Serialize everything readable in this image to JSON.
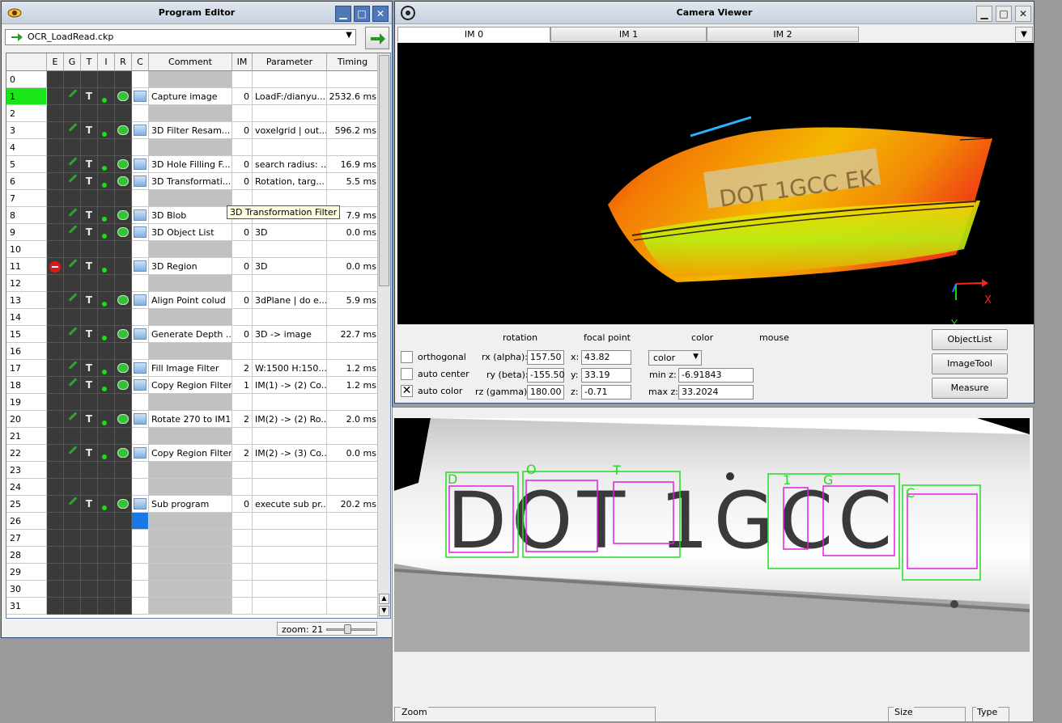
{
  "program_editor": {
    "title": "Program Editor",
    "file": "OCR_LoadRead.ckp",
    "columns": [
      "E",
      "G",
      "T",
      "I",
      "R",
      "C",
      "Comment",
      "IM",
      "Parameter",
      "Timing"
    ],
    "rows": [
      {
        "n": "0"
      },
      {
        "n": "1",
        "comment": "Capture image",
        "im": "0",
        "param": "LoadF:/dianyu...",
        "timing": "2532.6 ms",
        "en": true
      },
      {
        "n": "2"
      },
      {
        "n": "3",
        "comment": "3D Filter Resam...",
        "im": "0",
        "param": "voxelgrid | out...",
        "timing": "596.2 ms",
        "en": true
      },
      {
        "n": "4"
      },
      {
        "n": "5",
        "comment": "3D Hole Filling F...",
        "im": "0",
        "param": "search radius: ...",
        "timing": "16.9 ms",
        "en": true
      },
      {
        "n": "6",
        "comment": "3D Transformati...",
        "im": "0",
        "param": "Rotation, targ...",
        "timing": "5.5 ms",
        "en": true
      },
      {
        "n": "7"
      },
      {
        "n": "8",
        "comment": "3D Blob",
        "im": "",
        "param": "",
        "timing": "7.9 ms",
        "en": true
      },
      {
        "n": "9",
        "comment": "3D Object List",
        "im": "0",
        "param": "3D",
        "timing": "0.0 ms",
        "en": true
      },
      {
        "n": "10"
      },
      {
        "n": "11",
        "comment": "3D Region",
        "im": "0",
        "param": "3D",
        "timing": "0.0 ms",
        "en": true,
        "disabled": true
      },
      {
        "n": "12"
      },
      {
        "n": "13",
        "comment": "Align Point colud",
        "im": "0",
        "param": "3dPlane | do e...",
        "timing": "5.9 ms",
        "en": true
      },
      {
        "n": "14"
      },
      {
        "n": "15",
        "comment": "Generate Depth ...",
        "im": "0",
        "param": "3D -> image",
        "timing": "22.7 ms",
        "en": true
      },
      {
        "n": "16"
      },
      {
        "n": "17",
        "comment": "Fill Image Filter",
        "im": "2",
        "param": "W:1500 H:150...",
        "timing": "1.2 ms",
        "en": true
      },
      {
        "n": "18",
        "comment": "Copy Region Filter",
        "im": "1",
        "param": "IM(1) -> (2)  Co...",
        "timing": "1.2 ms",
        "en": true
      },
      {
        "n": "19"
      },
      {
        "n": "20",
        "comment": "Rotate 270 to IM1",
        "im": "2",
        "param": "IM(2) -> (2)  Ro...",
        "timing": "2.0 ms",
        "en": true
      },
      {
        "n": "21"
      },
      {
        "n": "22",
        "comment": "Copy Region Filter",
        "im": "2",
        "param": "IM(2) -> (3)  Co...",
        "timing": "0.0 ms",
        "en": true
      },
      {
        "n": "23"
      },
      {
        "n": "24"
      },
      {
        "n": "25",
        "comment": "Sub program",
        "im": "0",
        "param": "execute sub pr...",
        "timing": "20.2 ms",
        "en": true
      },
      {
        "n": "26"
      },
      {
        "n": "27"
      },
      {
        "n": "28"
      },
      {
        "n": "29"
      },
      {
        "n": "30"
      },
      {
        "n": "31"
      }
    ],
    "tooltip": "3D Transformation Filter",
    "zoom_label": "zoom: 21"
  },
  "camera_viewer": {
    "title": "Camera Viewer",
    "tabs": [
      "IM 0",
      "IM 1",
      "IM 2"
    ],
    "headers": {
      "rotation": "rotation",
      "focal": "focal point",
      "color": "color",
      "mouse": "mouse"
    },
    "options": [
      {
        "label": "orthogonal",
        "checked": false
      },
      {
        "label": "auto center",
        "checked": false
      },
      {
        "label": "auto color",
        "checked": true
      }
    ],
    "rot_labels": [
      "rx (alpha):",
      "ry (beta):",
      "rz (gamma):"
    ],
    "rot_values": [
      "157.50",
      "-155.50",
      "180.00"
    ],
    "fp_labels": [
      "x:",
      "y:",
      "z:"
    ],
    "fp_values": [
      "43.82",
      "33.19",
      "-0.71"
    ],
    "color_select": "color",
    "minz_label": "min z:",
    "minz": "-6.91843",
    "maxz_label": "max z:",
    "maxz": "33.2024",
    "buttons": [
      "ObjectList",
      "ImageTool",
      "Measure"
    ],
    "point_cloud_text": "DOT 1GCC EK",
    "axes": {
      "x": "X",
      "y": "Y"
    },
    "ocr_text": "DOT 1GCC",
    "ocr_labels": [
      "D",
      "O",
      "T",
      "1",
      "G",
      "C"
    ],
    "footer": {
      "zoom": "Zoom",
      "size": "Size",
      "type": "Type"
    }
  }
}
